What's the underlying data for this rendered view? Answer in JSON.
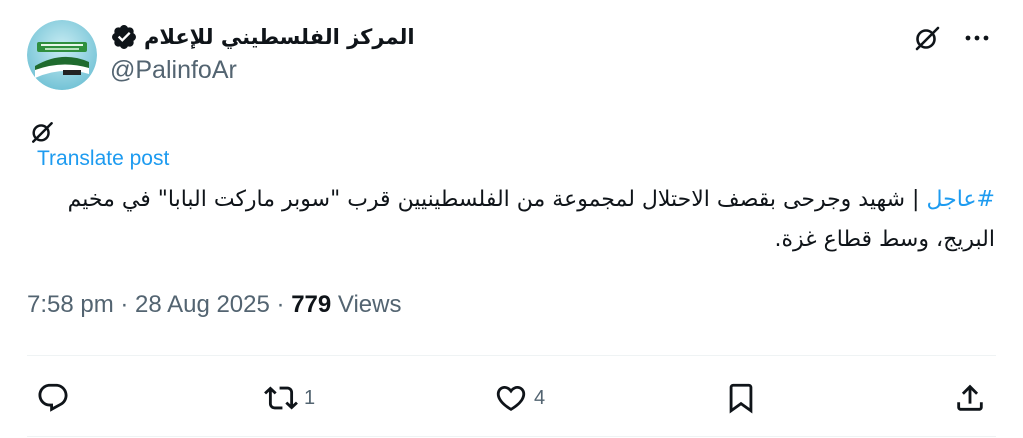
{
  "author": {
    "display_name": "المركز الفلسطيني للإعلام",
    "handle": "@PalinfoAr",
    "verified": true
  },
  "tweet": {
    "hashtag": "#عاجل",
    "text": " | شهيد وجرحى بقصف الاحتلال لمجموعة من الفلسطينيين قرب \"سوبر ماركت البابا\" في مخيم البريج، وسط قطاع غزة.",
    "translate_label": "Translate post",
    "time": "7:58 pm",
    "separator": " · ",
    "date": "28 Aug 2025",
    "views_count": "779",
    "views_label": " Views"
  },
  "actions": {
    "replies": "",
    "reposts": "1",
    "likes": "4"
  },
  "icons": {
    "top_right": [
      "grok-icon",
      "more-icon"
    ],
    "action_bar": [
      "reply-icon",
      "repost-icon",
      "like-icon",
      "bookmark-icon",
      "share-icon"
    ]
  },
  "colors": {
    "link": "#1d9bf0",
    "text": "#0f1419",
    "secondary": "#536471",
    "divider": "#eff3f4"
  }
}
